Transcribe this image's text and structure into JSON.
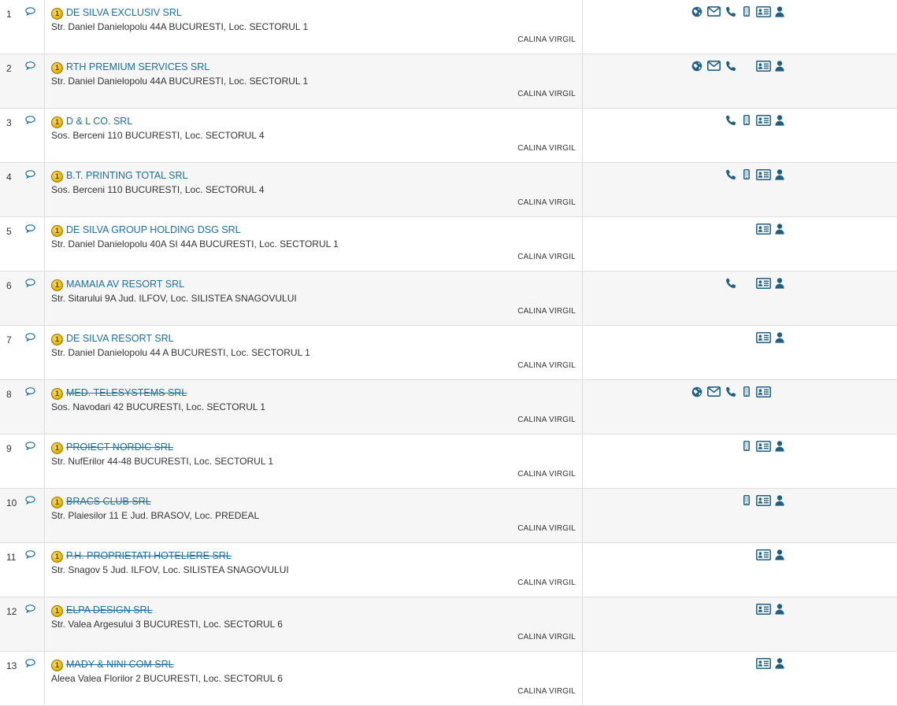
{
  "colors": {
    "link": "#1a6fa0",
    "icon": "#1f5f82",
    "coin": "#e6b800"
  },
  "rank_badge": "1",
  "rows": [
    {
      "num": "1",
      "name": "DE SILVA EXCLUSIV SRL",
      "address": "Str. Daniel Danielopolu 44A BUCURESTI, Loc. SECTORUL 1",
      "agent": "CALINA VIRGIL",
      "inactive": false,
      "icons": [
        "globe-icon",
        "mail-icon",
        "phone-icon",
        "mobile-icon",
        "id-card-icon",
        "person-icon"
      ]
    },
    {
      "num": "2",
      "name": "RTH PREMIUM SERVICES SRL",
      "address": "Str. Daniel Danielopolu 44A BUCURESTI, Loc. SECTORUL 1",
      "agent": "CALINA VIRGIL",
      "inactive": false,
      "icons": [
        "globe-icon",
        "mail-icon",
        "phone-icon",
        "id-card-icon",
        "person-icon"
      ]
    },
    {
      "num": "3",
      "name": "D & L CO. SRL",
      "address": "Sos. Berceni 110 BUCURESTI, Loc. SECTORUL 4",
      "agent": "CALINA VIRGIL",
      "inactive": false,
      "icons": [
        "phone-icon",
        "mobile-icon",
        "id-card-icon",
        "person-icon"
      ]
    },
    {
      "num": "4",
      "name": "B.T. PRINTING TOTAL SRL",
      "address": "Sos. Berceni 110 BUCURESTI, Loc. SECTORUL 4",
      "agent": "CALINA VIRGIL",
      "inactive": false,
      "icons": [
        "phone-icon",
        "mobile-icon",
        "id-card-icon",
        "person-icon"
      ]
    },
    {
      "num": "5",
      "name": "DE SILVA GROUP HOLDING DSG SRL",
      "address": "Str. Daniel Danielopolu 40A SI 44A BUCURESTI, Loc. SECTORUL 1",
      "agent": "CALINA VIRGIL",
      "inactive": false,
      "icons": [
        "id-card-icon",
        "person-icon"
      ]
    },
    {
      "num": "6",
      "name": "MAMAIA AV RESORT SRL",
      "address": "Str. Sitarului 9A Jud. ILFOV, Loc. SILISTEA SNAGOVULUI",
      "agent": "CALINA VIRGIL",
      "inactive": false,
      "icons": [
        "phone-icon",
        "id-card-icon",
        "person-icon"
      ]
    },
    {
      "num": "7",
      "name": "DE SILVA RESORT SRL",
      "address": "Str. Daniel Danielopolu 44 A BUCURESTI, Loc. SECTORUL 1",
      "agent": "CALINA VIRGIL",
      "inactive": false,
      "icons": [
        "id-card-icon",
        "person-icon"
      ]
    },
    {
      "num": "8",
      "name": "MED. TELESYSTEMS SRL",
      "address": "Sos. Navodari 42 BUCURESTI, Loc. SECTORUL 1",
      "agent": "CALINA VIRGIL",
      "inactive": true,
      "icons": [
        "globe-icon",
        "mail-icon",
        "phone-icon",
        "mobile-icon",
        "id-card-icon"
      ]
    },
    {
      "num": "9",
      "name": "PROIECT NORDIC SRL",
      "address": "Str. NufErilor 44-48 BUCURESTI, Loc. SECTORUL 1",
      "agent": "CALINA VIRGIL",
      "inactive": true,
      "icons": [
        "mobile-icon",
        "id-card-icon",
        "person-icon"
      ]
    },
    {
      "num": "10",
      "name": "BRACS CLUB SRL",
      "address": "Str. Plaiesilor 11 E Jud. BRASOV, Loc. PREDEAL",
      "agent": "CALINA VIRGIL",
      "inactive": true,
      "icons": [
        "mobile-icon",
        "id-card-icon",
        "person-icon"
      ]
    },
    {
      "num": "11",
      "name": "P.H. PROPRIETATI HOTELIERE SRL",
      "address": "Str. Snagov 5 Jud. ILFOV, Loc. SILISTEA SNAGOVULUI",
      "agent": "CALINA VIRGIL",
      "inactive": true,
      "icons": [
        "id-card-icon",
        "person-icon"
      ]
    },
    {
      "num": "12",
      "name": "ELPA DESIGN SRL",
      "address": "Str. Valea Argesului 3 BUCURESTI, Loc. SECTORUL 6",
      "agent": "CALINA VIRGIL",
      "inactive": true,
      "icons": [
        "id-card-icon",
        "person-icon"
      ]
    },
    {
      "num": "13",
      "name": "MADY & NINI COM SRL",
      "address": "Aleea Valea Florilor 2 BUCURESTI, Loc. SECTORUL 6",
      "agent": "CALINA VIRGIL",
      "inactive": true,
      "icons": [
        "id-card-icon",
        "person-icon"
      ]
    }
  ]
}
